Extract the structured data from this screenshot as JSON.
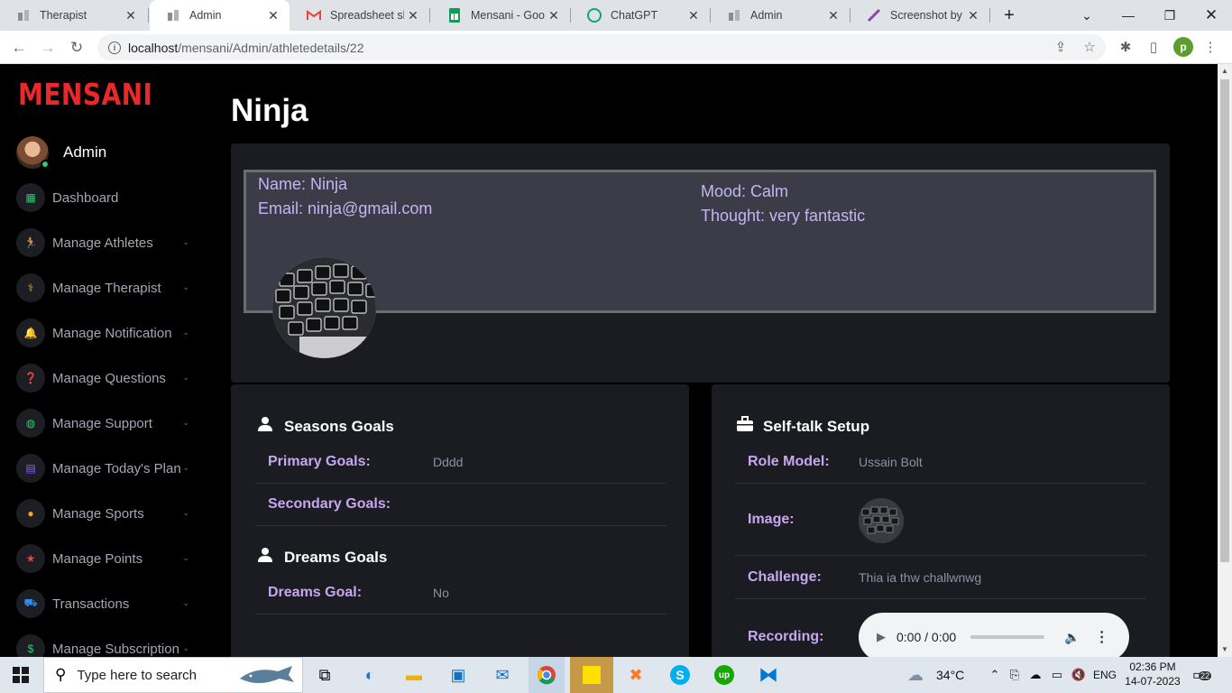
{
  "browser": {
    "tabs": [
      {
        "title": "Therapist",
        "active": false
      },
      {
        "title": "Admin",
        "active": true
      },
      {
        "title": "Spreadsheet shar",
        "active": false
      },
      {
        "title": "Mensani - Googl",
        "active": false
      },
      {
        "title": "ChatGPT",
        "active": false
      },
      {
        "title": "Admin",
        "active": false
      },
      {
        "title": "Screenshot by Lig",
        "active": false
      }
    ],
    "url_host": "localhost",
    "url_path": "/mensani/Admin/athletedetails/22",
    "profile_letter": "p"
  },
  "sidebar": {
    "logo": "MENSANI",
    "user": "Admin",
    "items": [
      {
        "label": "Dashboard",
        "icon": "dashboard-icon",
        "color": "#2ecc71",
        "glyph": "▦"
      },
      {
        "label": "Manage Athletes",
        "icon": "running-icon",
        "color": "#8e5cf7",
        "glyph": "🏃"
      },
      {
        "label": "Manage Therapist",
        "icon": "stethoscope-icon",
        "color": "#f5a623",
        "glyph": "⚕"
      },
      {
        "label": "Manage Notification",
        "icon": "bell-icon",
        "color": "#e8424b",
        "glyph": "🔔"
      },
      {
        "label": "Manage Questions",
        "icon": "question-icon",
        "color": "#2f8cf5",
        "glyph": "❓"
      },
      {
        "label": "Manage Support",
        "icon": "globe-icon",
        "color": "#2ecc71",
        "glyph": "◍"
      },
      {
        "label": "Manage Today's Plan",
        "icon": "calendar-icon",
        "color": "#8e5cf7",
        "glyph": "▤"
      },
      {
        "label": "Manage Sports",
        "icon": "basketball-icon",
        "color": "#f5a623",
        "glyph": "●"
      },
      {
        "label": "Manage Points",
        "icon": "star-icon",
        "color": "#e8424b",
        "glyph": "★"
      },
      {
        "label": "Transactions",
        "icon": "truck-icon",
        "color": "#2f8cf5",
        "glyph": "⛟"
      },
      {
        "label": "Manage Subscription",
        "icon": "dollar-icon",
        "color": "#2ecc71",
        "glyph": "$"
      }
    ]
  },
  "main": {
    "title": "Ninja",
    "info": {
      "name": "Name: Ninja",
      "email": "Email: ninja@gmail.com",
      "mood": "Mood: Calm",
      "thought": "Thought: very fantastic"
    },
    "goals": {
      "seasons_heading": "Seasons Goals",
      "primary_label": "Primary Goals:",
      "primary_value": "Dddd",
      "secondary_label": "Secondary Goals:",
      "secondary_value": "",
      "dreams_heading": "Dreams Goals",
      "dreams_label": "Dreams Goal:",
      "dreams_value": "No"
    },
    "selftalk": {
      "heading": "Self-talk Setup",
      "role_label": "Role Model:",
      "role_value": "Ussain Bolt",
      "image_label": "Image:",
      "challenge_label": "Challenge:",
      "challenge_value": "Thia ia thw challwnwg",
      "recording_label": "Recording:",
      "audio_time": "0:00 / 0:00"
    }
  },
  "taskbar": {
    "search_placeholder": "Type here to search",
    "temperature": "34°C",
    "language": "ENG",
    "time": "02:36 PM",
    "date": "14-07-2023",
    "notification_count": "22"
  }
}
